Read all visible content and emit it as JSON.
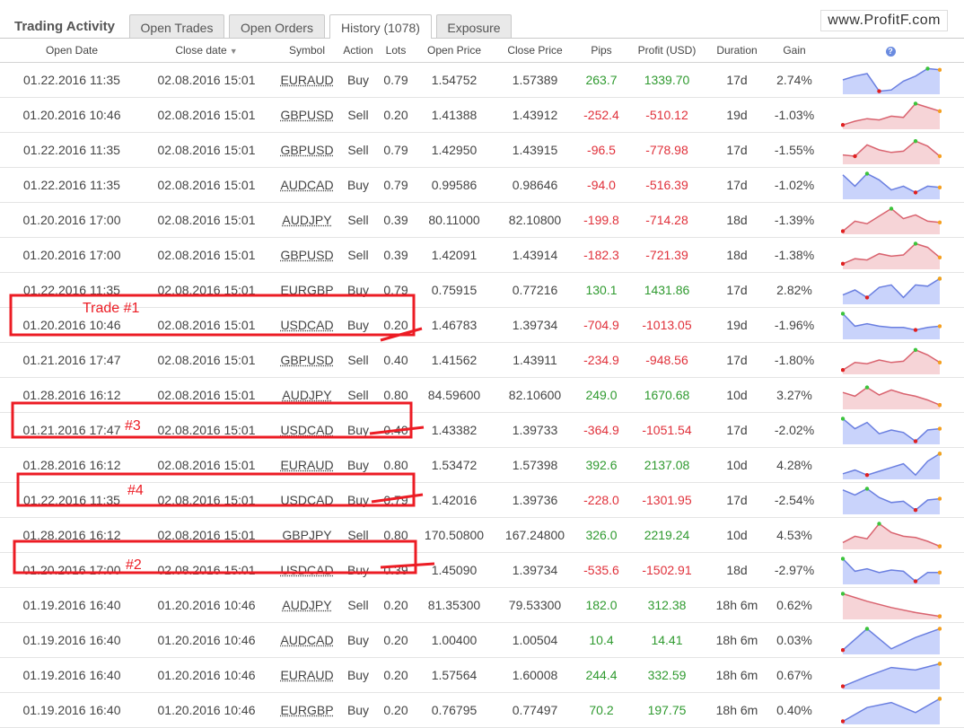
{
  "header": {
    "title": "Trading Activity",
    "tabs": [
      "Open Trades",
      "Open Orders",
      "History (1078)",
      "Exposure"
    ],
    "active_tab": 2,
    "watermark": "www.ProfitF.com"
  },
  "columns": [
    "Open Date",
    "Close date",
    "Symbol",
    "Action",
    "Lots",
    "Open Price",
    "Close Price",
    "Pips",
    "Profit (USD)",
    "Duration",
    "Gain"
  ],
  "help_icon_label": "?",
  "colors": {
    "profit": "#2f9a2f",
    "loss": "#e0303a",
    "spark_up": "#6a7fe0",
    "spark_down": "#d9636f"
  },
  "rows": [
    {
      "open": "01.22.2016 11:35",
      "close": "02.08.2016 15:01",
      "symbol": "EURAUD",
      "action": "Buy",
      "lots": "0.79",
      "open_price": "1.54752",
      "close_price": "1.57389",
      "pips": "263.7",
      "profit": "1339.70",
      "duration": "17d",
      "gain": "2.74%",
      "spark": [
        0.5,
        0.35,
        0.25,
        0.95,
        0.9,
        0.55,
        0.35,
        0.05,
        0.1
      ]
    },
    {
      "open": "01.20.2016 10:46",
      "close": "02.08.2016 15:01",
      "symbol": "GBPUSD",
      "action": "Sell",
      "lots": "0.20",
      "open_price": "1.41388",
      "close_price": "1.43912",
      "pips": "-252.4",
      "profit": "-510.12",
      "duration": "19d",
      "gain": "-1.03%",
      "spark": [
        0.9,
        0.75,
        0.65,
        0.7,
        0.55,
        0.6,
        0.05,
        0.2,
        0.35
      ]
    },
    {
      "open": "01.22.2016 11:35",
      "close": "02.08.2016 15:01",
      "symbol": "GBPUSD",
      "action": "Sell",
      "lots": "0.79",
      "open_price": "1.42950",
      "close_price": "1.43915",
      "pips": "-96.5",
      "profit": "-778.98",
      "duration": "17d",
      "gain": "-1.55%",
      "spark": [
        0.7,
        0.75,
        0.3,
        0.5,
        0.6,
        0.55,
        0.15,
        0.35,
        0.75
      ]
    },
    {
      "open": "01.22.2016 11:35",
      "close": "02.08.2016 15:01",
      "symbol": "AUDCAD",
      "action": "Buy",
      "lots": "0.79",
      "open_price": "0.99586",
      "close_price": "0.98646",
      "pips": "-94.0",
      "profit": "-516.39",
      "duration": "17d",
      "gain": "-1.02%",
      "spark": [
        0.1,
        0.55,
        0.05,
        0.3,
        0.7,
        0.55,
        0.8,
        0.55,
        0.6
      ]
    },
    {
      "open": "01.20.2016 17:00",
      "close": "02.08.2016 15:01",
      "symbol": "AUDJPY",
      "action": "Sell",
      "lots": "0.39",
      "open_price": "80.11000",
      "close_price": "82.10800",
      "pips": "-199.8",
      "profit": "-714.28",
      "duration": "18d",
      "gain": "-1.39%",
      "spark": [
        0.95,
        0.55,
        0.65,
        0.35,
        0.05,
        0.45,
        0.3,
        0.55,
        0.6
      ]
    },
    {
      "open": "01.20.2016 17:00",
      "close": "02.08.2016 15:01",
      "symbol": "GBPUSD",
      "action": "Sell",
      "lots": "0.39",
      "open_price": "1.42091",
      "close_price": "1.43914",
      "pips": "-182.3",
      "profit": "-721.39",
      "duration": "18d",
      "gain": "-1.38%",
      "spark": [
        0.85,
        0.65,
        0.7,
        0.45,
        0.55,
        0.5,
        0.05,
        0.2,
        0.6
      ]
    },
    {
      "open": "01.22.2016 11:35",
      "close": "02.08.2016 15:01",
      "symbol": "EURGBP",
      "action": "Buy",
      "lots": "0.79",
      "open_price": "0.75915",
      "close_price": "0.77216",
      "pips": "130.1",
      "profit": "1431.86",
      "duration": "17d",
      "gain": "2.82%",
      "spark": [
        0.7,
        0.5,
        0.8,
        0.4,
        0.3,
        0.8,
        0.3,
        0.35,
        0.05
      ]
    },
    {
      "open": "01.20.2016 10:46",
      "close": "02.08.2016 15:01",
      "symbol": "USDCAD",
      "action": "Buy",
      "lots": "0.20",
      "open_price": "1.46783",
      "close_price": "1.39734",
      "pips": "-704.9",
      "profit": "-1013.05",
      "duration": "19d",
      "gain": "-1.96%",
      "spark": [
        0.05,
        0.55,
        0.45,
        0.55,
        0.6,
        0.6,
        0.7,
        0.6,
        0.55
      ]
    },
    {
      "open": "01.21.2016 17:47",
      "close": "02.08.2016 15:01",
      "symbol": "GBPUSD",
      "action": "Sell",
      "lots": "0.40",
      "open_price": "1.41562",
      "close_price": "1.43911",
      "pips": "-234.9",
      "profit": "-948.56",
      "duration": "17d",
      "gain": "-1.80%",
      "spark": [
        0.9,
        0.6,
        0.65,
        0.5,
        0.6,
        0.55,
        0.1,
        0.3,
        0.6
      ]
    },
    {
      "open": "01.28.2016 16:12",
      "close": "02.08.2016 15:01",
      "symbol": "AUDJPY",
      "action": "Sell",
      "lots": "0.80",
      "open_price": "84.59600",
      "close_price": "82.10600",
      "pips": "249.0",
      "profit": "1670.68",
      "duration": "10d",
      "gain": "3.27%",
      "spark": [
        0.4,
        0.55,
        0.2,
        0.5,
        0.3,
        0.45,
        0.55,
        0.7,
        0.9
      ]
    },
    {
      "open": "01.21.2016 17:47",
      "close": "02.08.2016 15:01",
      "symbol": "USDCAD",
      "action": "Buy",
      "lots": "0.40",
      "open_price": "1.43382",
      "close_price": "1.39733",
      "pips": "-364.9",
      "profit": "-1051.54",
      "duration": "17d",
      "gain": "-2.02%",
      "spark": [
        0.05,
        0.45,
        0.2,
        0.65,
        0.5,
        0.6,
        0.95,
        0.5,
        0.45
      ]
    },
    {
      "open": "01.28.2016 16:12",
      "close": "02.08.2016 15:01",
      "symbol": "EURAUD",
      "action": "Buy",
      "lots": "0.80",
      "open_price": "1.53472",
      "close_price": "1.57398",
      "pips": "392.6",
      "profit": "2137.08",
      "duration": "10d",
      "gain": "4.28%",
      "spark": [
        0.85,
        0.7,
        0.9,
        0.75,
        0.6,
        0.45,
        0.9,
        0.35,
        0.05
      ]
    },
    {
      "open": "01.22.2016 11:35",
      "close": "02.08.2016 15:01",
      "symbol": "USDCAD",
      "action": "Buy",
      "lots": "0.79",
      "open_price": "1.42016",
      "close_price": "1.39736",
      "pips": "-228.0",
      "profit": "-1301.95",
      "duration": "17d",
      "gain": "-2.54%",
      "spark": [
        0.1,
        0.3,
        0.05,
        0.4,
        0.6,
        0.55,
        0.9,
        0.5,
        0.45
      ]
    },
    {
      "open": "01.28.2016 16:12",
      "close": "02.08.2016 15:01",
      "symbol": "GBPJPY",
      "action": "Sell",
      "lots": "0.80",
      "open_price": "170.50800",
      "close_price": "167.24800",
      "pips": "326.0",
      "profit": "2219.24",
      "duration": "10d",
      "gain": "4.53%",
      "spark": [
        0.8,
        0.55,
        0.65,
        0.05,
        0.4,
        0.55,
        0.6,
        0.75,
        0.95
      ]
    },
    {
      "open": "01.20.2016 17:00",
      "close": "02.08.2016 15:01",
      "symbol": "USDCAD",
      "action": "Buy",
      "lots": "0.39",
      "open_price": "1.45090",
      "close_price": "1.39734",
      "pips": "-535.6",
      "profit": "-1502.91",
      "duration": "18d",
      "gain": "-2.97%",
      "spark": [
        0.05,
        0.55,
        0.45,
        0.6,
        0.5,
        0.55,
        0.95,
        0.6,
        0.6
      ]
    },
    {
      "open": "01.19.2016 16:40",
      "close": "01.20.2016 10:46",
      "symbol": "AUDJPY",
      "action": "Sell",
      "lots": "0.20",
      "open_price": "81.35300",
      "close_price": "79.53300",
      "pips": "182.0",
      "profit": "312.38",
      "duration": "18h 6m",
      "gain": "0.62%",
      "spark": [
        0.05,
        0.35,
        0.6,
        0.8,
        0.95
      ]
    },
    {
      "open": "01.19.2016 16:40",
      "close": "01.20.2016 10:46",
      "symbol": "AUDCAD",
      "action": "Buy",
      "lots": "0.20",
      "open_price": "1.00400",
      "close_price": "1.00504",
      "pips": "10.4",
      "profit": "14.41",
      "duration": "18h 6m",
      "gain": "0.03%",
      "spark": [
        0.9,
        0.05,
        0.85,
        0.4,
        0.05
      ]
    },
    {
      "open": "01.19.2016 16:40",
      "close": "01.20.2016 10:46",
      "symbol": "EURAUD",
      "action": "Buy",
      "lots": "0.20",
      "open_price": "1.57564",
      "close_price": "1.60008",
      "pips": "244.4",
      "profit": "332.59",
      "duration": "18h 6m",
      "gain": "0.67%",
      "spark": [
        0.95,
        0.55,
        0.2,
        0.3,
        0.05
      ]
    },
    {
      "open": "01.19.2016 16:40",
      "close": "01.20.2016 10:46",
      "symbol": "EURGBP",
      "action": "Buy",
      "lots": "0.20",
      "open_price": "0.76795",
      "close_price": "0.77497",
      "pips": "70.2",
      "profit": "197.75",
      "duration": "18h 6m",
      "gain": "0.40%",
      "spark": [
        0.95,
        0.4,
        0.2,
        0.6,
        0.05
      ]
    }
  ],
  "annotations": [
    "Trade #1",
    "#3",
    "#4",
    "#2"
  ]
}
